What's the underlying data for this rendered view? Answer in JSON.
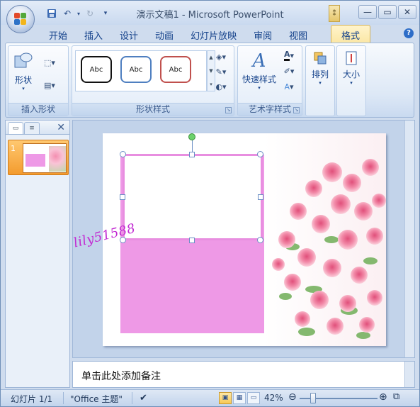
{
  "window": {
    "title": "演示文稿1 - Microsoft PowerPoint"
  },
  "qat": {
    "save_icon": "save-icon",
    "undo_icon": "undo-icon",
    "redo_icon": "redo-icon",
    "customize_icon": "dropdown-icon"
  },
  "tabs": [
    {
      "label": "开始"
    },
    {
      "label": "插入"
    },
    {
      "label": "设计"
    },
    {
      "label": "动画"
    },
    {
      "label": "幻灯片放映"
    },
    {
      "label": "审阅"
    },
    {
      "label": "视图"
    }
  ],
  "context_tab": {
    "label": "格式"
  },
  "ribbon": {
    "insert_shapes": {
      "label": "插入形状",
      "shapes_button": "形状"
    },
    "shape_styles": {
      "label": "形状样式",
      "presets": [
        "Abc",
        "Abc",
        "Abc"
      ]
    },
    "wordart_styles": {
      "label": "艺术字样式",
      "quick_styles_button": "快速样式"
    },
    "arrange": {
      "button": "排列"
    },
    "size": {
      "button": "大小"
    }
  },
  "left_pane": {
    "slide_number": "1"
  },
  "slide": {
    "watermark": "lily51588"
  },
  "notes": {
    "placeholder": "单击此处添加备注"
  },
  "status": {
    "slide_info": "幻灯片 1/1",
    "theme": "\"Office 主题\"",
    "zoom": "42%",
    "zoom_level": 0.42
  },
  "colors": {
    "accent": "#ee99e6",
    "ribbon": "#dde8f6",
    "context_tab": "#fbe7a6"
  }
}
